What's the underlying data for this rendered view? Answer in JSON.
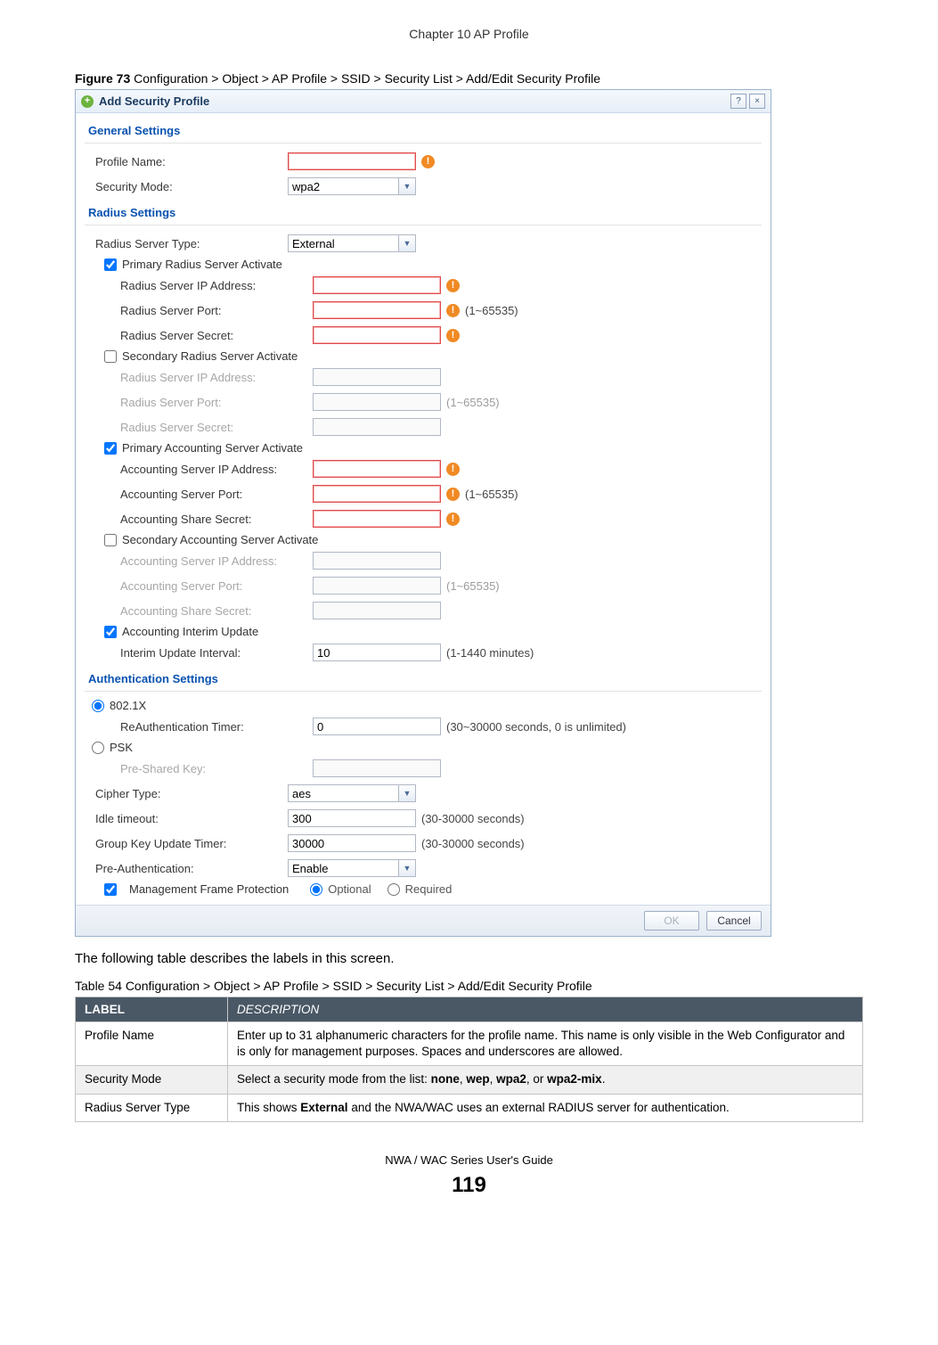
{
  "chapter_header": "Chapter 10 AP Profile",
  "figure_caption_bold": "Figure 73",
  "figure_caption_rest": "   Configuration > Object > AP Profile > SSID > Security List > Add/Edit Security Profile",
  "dialog": {
    "add_icon": "+",
    "title": "Add Security Profile",
    "help_icon": "?",
    "close_icon": "×",
    "sections": {
      "general": "General Settings",
      "radius": "Radius Settings",
      "auth": "Authentication Settings"
    },
    "labels": {
      "profile_name": "Profile Name:",
      "security_mode": "Security Mode:",
      "radius_type": "Radius Server Type:",
      "primary_radius_act": "Primary Radius Server Activate",
      "r_ip": "Radius Server IP Address:",
      "r_port": "Radius Server Port:",
      "r_secret": "Radius Server Secret:",
      "secondary_radius_act": "Secondary Radius Server Activate",
      "primary_acct_act": "Primary Accounting Server Activate",
      "a_ip": "Accounting Server IP Address:",
      "a_port": "Accounting Server Port:",
      "a_secret": "Accounting Share Secret:",
      "secondary_acct_act": "Secondary Accounting Server Activate",
      "acct_interim": "Accounting Interim Update",
      "interim_interval": "Interim Update Interval:",
      "dot1x": "802.1X",
      "reauth": "ReAuthentication Timer:",
      "psk": "PSK",
      "psk_key": "Pre-Shared Key:",
      "cipher": "Cipher Type:",
      "idle": "Idle timeout:",
      "gkey": "Group Key Update Timer:",
      "preauth": "Pre-Authentication:",
      "mfp": "Management Frame Protection",
      "mfp_opt": "Optional",
      "mfp_req": "Required"
    },
    "values": {
      "security_mode": "wpa2",
      "radius_type": "External",
      "interim_interval": "10",
      "reauth": "0",
      "cipher": "aes",
      "idle": "300",
      "gkey": "30000",
      "preauth": "Enable"
    },
    "hints": {
      "port_range": "(1~65535)",
      "interim": "(1-1440 minutes)",
      "reauth": "(30~30000 seconds, 0 is unlimited)",
      "idle": "(30-30000 seconds)",
      "gkey": "(30-30000 seconds)"
    },
    "warn_glyph": "!",
    "buttons": {
      "ok": "OK",
      "cancel": "Cancel"
    }
  },
  "after_text": "The following table describes the labels in this screen.",
  "table_caption": "Table 54   Configuration > Object > AP Profile > SSID > Security List > Add/Edit Security Profile",
  "table": {
    "head": {
      "c1": "LABEL",
      "c2": "DESCRIPTION"
    },
    "rows": [
      {
        "c1": "Profile Name",
        "c2_pre": "Enter up to 31 alphanumeric characters for the profile name. This name is only visible in the Web Configurator and is only for management purposes. Spaces and underscores are allowed."
      },
      {
        "c1": "Security Mode",
        "c2_pre": "Select a security mode from the list: ",
        "b1": "none",
        "sep1": ", ",
        "b2": "wep",
        "sep2": ", ",
        "b3": "wpa2",
        "sep3": ", or ",
        "b4": "wpa2-mix",
        "post": "."
      },
      {
        "c1": "Radius Server Type",
        "c2_pre": "This shows ",
        "b1": "External",
        "post": " and the NWA/WAC uses an external RADIUS server for authentication."
      }
    ]
  },
  "footer_line": "NWA / WAC Series User's Guide",
  "footer_page": "119"
}
